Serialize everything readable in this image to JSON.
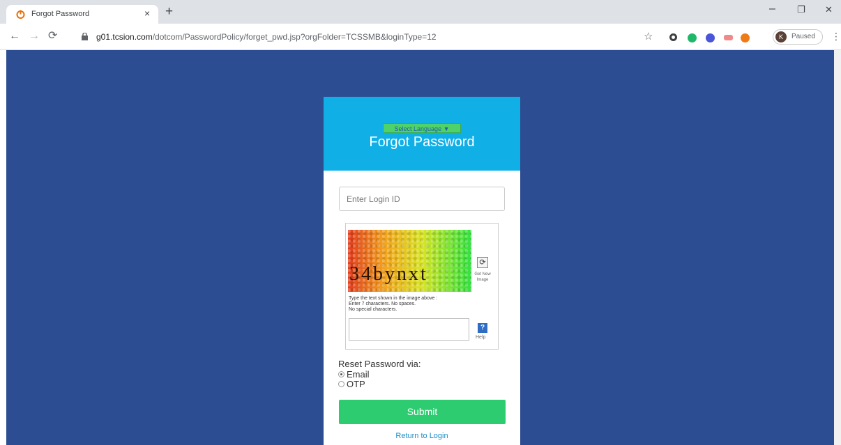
{
  "browser": {
    "tab_title": "Forgot Password",
    "tab_close": "×",
    "new_tab": "+",
    "url_host": "g01.tcsion.com",
    "url_path": "/dotcom/PasswordPolicy/forget_pwd.jsp?orgFolder=TCSSMB&loginType=12",
    "profile_initial": "K",
    "profile_status": "Paused",
    "window_controls": {
      "minimize": "–",
      "maximize": "❐",
      "close": "✕"
    }
  },
  "form": {
    "language_select": "Select Language ▼",
    "title": "Forgot Password",
    "login_placeholder": "Enter Login ID",
    "captcha": {
      "image_text": "34bynxt",
      "refresh_label": "Get New Image",
      "instructions": [
        "Type the text shown in the image above :",
        "Enter 7 characters. No spaces.",
        "No special characters."
      ],
      "help_icon": "?",
      "help_label": "Help"
    },
    "reset_via_label": "Reset Password via:",
    "options": [
      {
        "label": "Email",
        "checked": true
      },
      {
        "label": "OTP",
        "checked": false
      }
    ],
    "submit_label": "Submit",
    "return_link": "Return to Login"
  },
  "colors": {
    "page_background": "#2d4d92",
    "header": "#10b0e7",
    "submit": "#2ecc71"
  }
}
